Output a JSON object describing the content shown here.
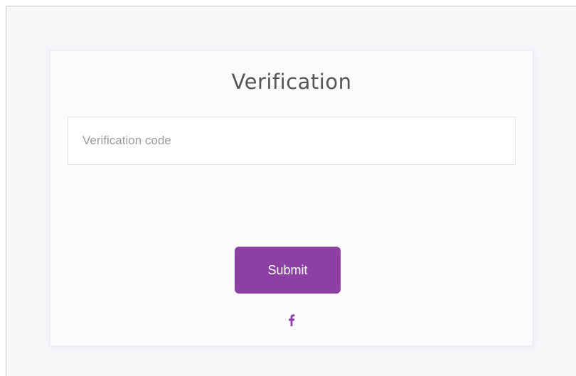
{
  "card": {
    "title": "Verification"
  },
  "form": {
    "code_placeholder": "Verification code",
    "code_value": "",
    "submit_label": "Submit"
  },
  "social": {
    "icon": "facebook-icon"
  },
  "colors": {
    "accent": "#8e3fa4",
    "page_background": "#f6f6f8",
    "card_background": "#fbfbfd",
    "title_text": "#555555",
    "placeholder_text": "#9a9a9a"
  }
}
